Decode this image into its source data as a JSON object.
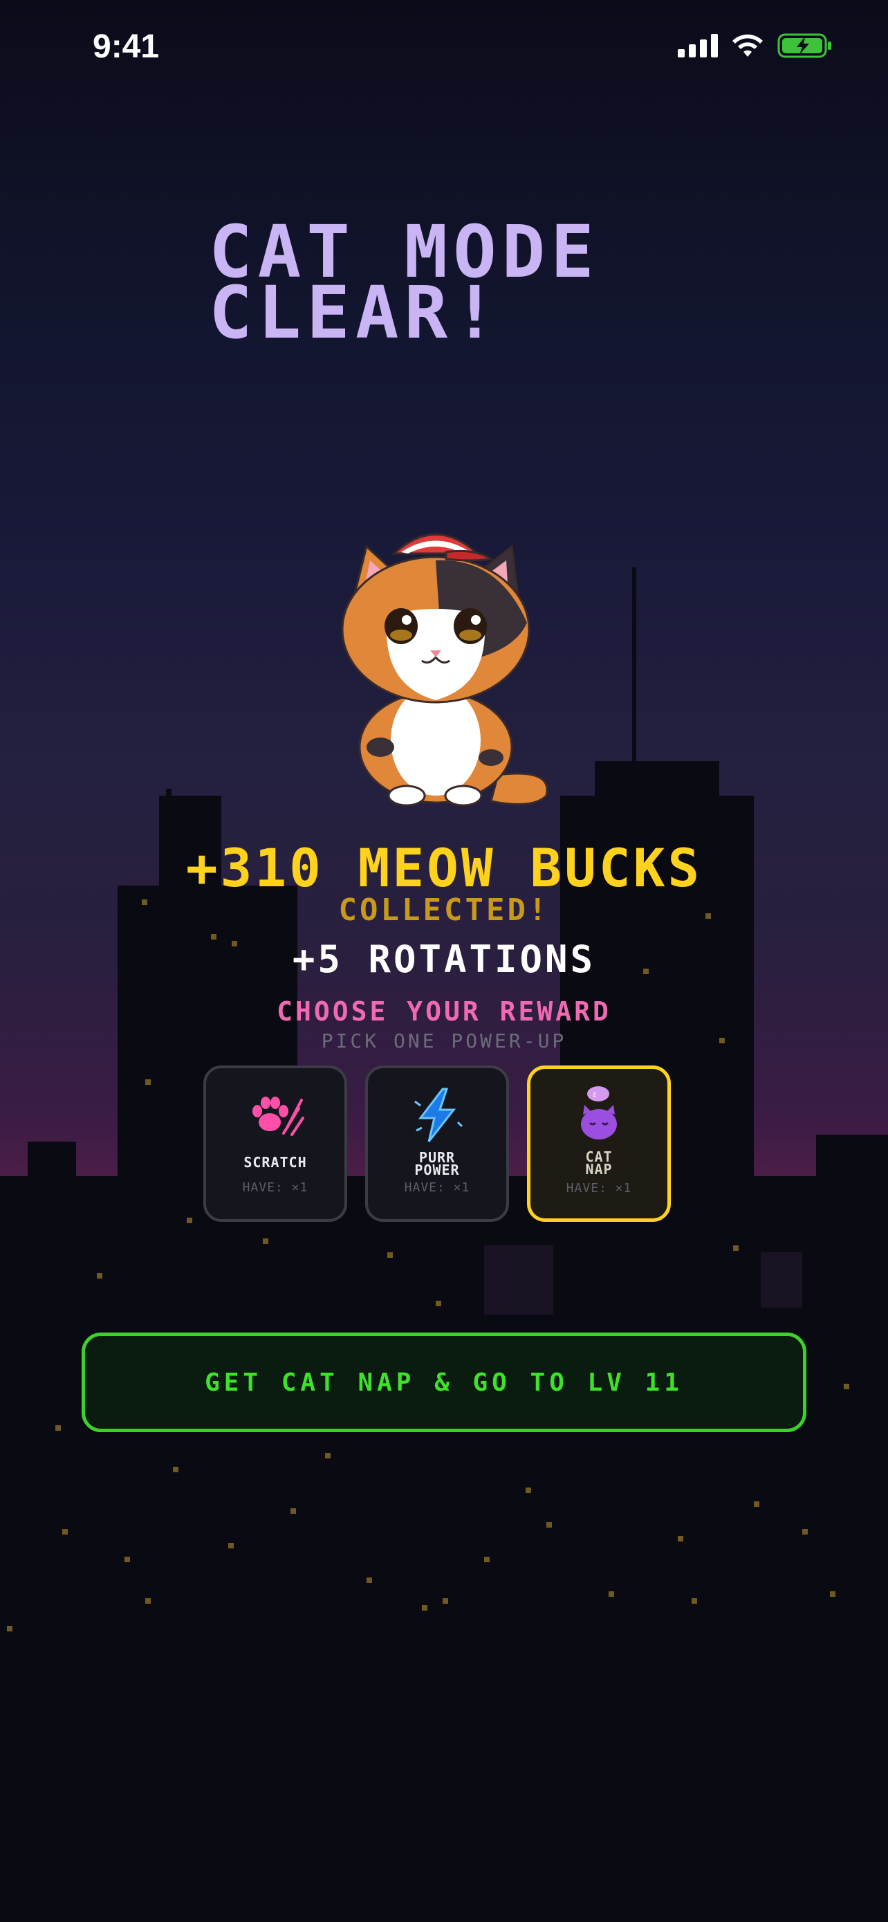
{
  "status_bar": {
    "time": "9:41"
  },
  "title": {
    "line1": "CAT MODE",
    "line2": "CLEAR!"
  },
  "rewards": {
    "bucks": "+310 MEOW BUCKS",
    "collected": "COLLECTED!",
    "rotations": "+5 ROTATIONS"
  },
  "choose": {
    "heading": "CHOOSE YOUR REWARD",
    "subheading": "PICK ONE POWER-UP"
  },
  "cards": [
    {
      "name": "SCRATCH",
      "have": "HAVE: ×1",
      "icon": "paw-scratch-icon",
      "selected": false
    },
    {
      "name": "PURR\nPOWER",
      "have": "HAVE: ×1",
      "icon": "lightning-icon",
      "selected": false
    },
    {
      "name": "CAT\nNAP",
      "have": "HAVE: ×1",
      "icon": "sleeping-cat-icon",
      "selected": true
    }
  ],
  "cta": {
    "label": "GET CAT NAP & GO TO LV 11"
  },
  "colors": {
    "title": "#c9b4f4",
    "bucks": "#ffd21e",
    "accent_pink": "#f06ab3",
    "cta_green": "#3fe22a",
    "selected_border": "#ffd21e"
  }
}
